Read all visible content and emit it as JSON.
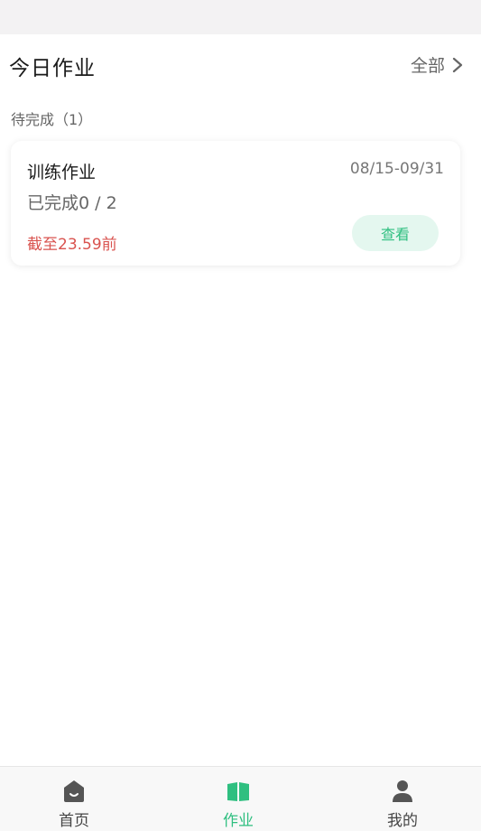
{
  "header": {
    "title": "今日作业",
    "view_all_label": "全部"
  },
  "section": {
    "pending_label": "待完成（1）"
  },
  "task": {
    "title": "训练作业",
    "date_range": "08/15-09/31",
    "progress": "已完成0 / 2",
    "deadline": "截至23.59前",
    "view_button_label": "查看"
  },
  "tabbar": {
    "items": [
      {
        "label": "首页",
        "icon": "home-icon",
        "active": false
      },
      {
        "label": "作业",
        "icon": "book-icon",
        "active": true
      },
      {
        "label": "我的",
        "icon": "user-icon",
        "active": false
      }
    ]
  },
  "colors": {
    "accent": "#2fbf80",
    "deadline": "#d9534f",
    "button_bg": "#e4f7ef"
  }
}
